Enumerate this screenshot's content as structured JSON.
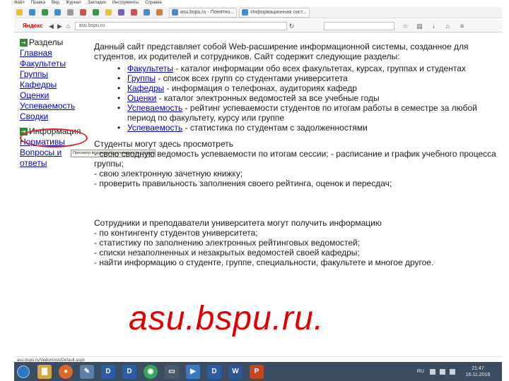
{
  "browser": {
    "menu": [
      "Файл",
      "Правка",
      "Вид",
      "Журнал",
      "Закладки",
      "Инструменты",
      "Справка"
    ],
    "brand": "Яндекс",
    "url": "asu.bspu.ru",
    "tabs": [
      "asu.bspu.ru - Понятно...",
      "Информационная сист..."
    ]
  },
  "sidebar": {
    "section1_title": "Разделы",
    "section1_items": [
      "Главная",
      "Факультеты",
      "Группы",
      "Кафедры",
      "Оценки",
      "Успеваемость",
      "Сводки"
    ],
    "section2_title": "Информация",
    "section2_items": [
      "Нормативы",
      "Вопросы и ответы"
    ]
  },
  "tooltip": "Просмотр ведомостей успеваемости студентов",
  "main": {
    "intro": "Данный сайт представляет собой Web-расширение информационной системы, созданное для студентов, их родителей и сотрудников. Сайт содержит следующие разделы:",
    "sections": [
      {
        "link": "Факультеты",
        "text": " - каталог информации обо всех факультетах, курсах, группах и студентах"
      },
      {
        "link": "Группы",
        "text": " - список всех групп со студентами университета"
      },
      {
        "link": "Кафедры",
        "text": " - информация о телефонах, аудиториях кафедр"
      },
      {
        "link": "Оценки",
        "text": " - каталог электронных ведомостей за все учебные годы"
      },
      {
        "link": "Успеваемость",
        "text": " - рейтинг успеваемости студентов по итогам работы в семестре за любой период по факультету, курсу или группе"
      },
      {
        "link": "Успеваемость",
        "text": " - статистика по студентам с задолженностями"
      }
    ],
    "students": [
      "Студенты могут здесь просмотреть",
      "- свою сводную ведомость успеваемости по итогам сессии; - расписание и график учебного процесса группы;",
      "- свою электронную зачетную книжку;",
      "- проверить правильность заполнения своего рейтинга, оценок и пересдач;"
    ],
    "staff": [
      "Сотрудники и преподаватели университета могут получить информацию",
      "- по контингенту студентов университета;",
      "- статистику по заполнению электронных рейтинговых ведомостей;",
      "- списки незаполненных и незакрытых ведомостей своей кафедры;",
      "- найти информацию о студенте, группе, специальности, факультете и многое другое."
    ]
  },
  "overlay_url": "asu.bspu.ru.",
  "statusbar": "asu.bspu.ru/Vedomosti/Default.aspx",
  "taskbar": {
    "lang": "RU",
    "time": "21:47",
    "date": "16.11.2016"
  },
  "colors": {
    "link": "#0000cc",
    "overlay": "#e00000",
    "annotation_circle": "#d42a2a",
    "taskbar": "#3a4d63"
  }
}
